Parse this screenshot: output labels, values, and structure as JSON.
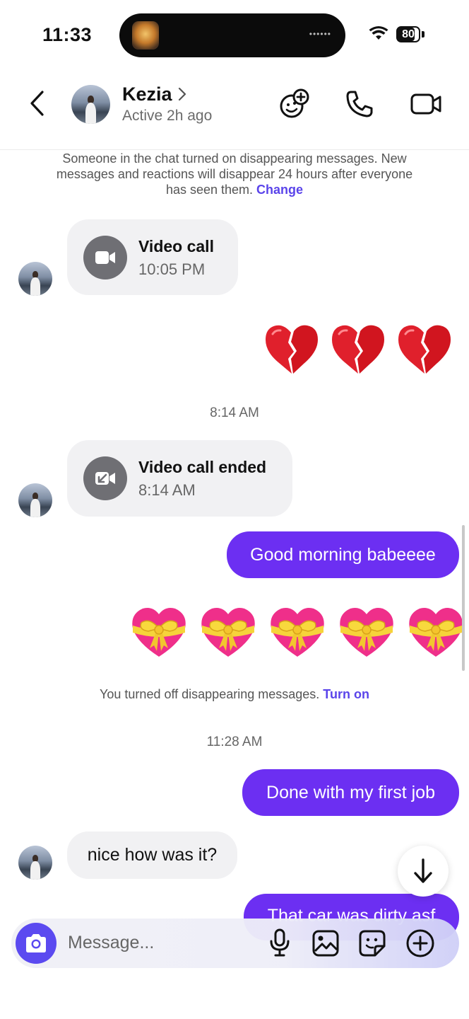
{
  "status_bar": {
    "time": "11:33",
    "island_dots": "••••••",
    "battery_level": 80,
    "battery_text": "80"
  },
  "header": {
    "contact_name": "Kezia",
    "status": "Active 2h ago"
  },
  "messages": {
    "system_notice_1": "Someone in the chat turned on disappearing messages. New messages and reactions will disappear 24 hours after everyone has seen them.",
    "system_notice_1_link": "Change",
    "video_call": {
      "title": "Video call",
      "time": "10:05 PM"
    },
    "broken_hearts": [
      "💔",
      "💔",
      "💔"
    ],
    "timestamp_1": "8:14 AM",
    "video_call_ended": {
      "title": "Video call ended",
      "time": "8:14 AM"
    },
    "sent_1": "Good morning babeeee",
    "gift_hearts": [
      "💝",
      "💝",
      "💝",
      "💝",
      "💝"
    ],
    "system_notice_2": "You turned off disappearing messages.",
    "system_notice_2_link": "Turn on",
    "timestamp_2": "11:28 AM",
    "sent_2": "Done with my first job",
    "received_1": "nice how was it?",
    "sent_3_partial": "That car was dirty asf"
  },
  "composer": {
    "placeholder": "Message..."
  },
  "colors": {
    "accent": "#6c2ff2",
    "link": "#5a44ea",
    "camera_button": "#5b4af0",
    "received_bubble": "#f1f1f3"
  },
  "icons": {
    "back": "chevron-left-icon",
    "effects": "smiley-plus-icon",
    "call": "phone-icon",
    "video": "video-camera-icon",
    "camera": "camera-icon",
    "mic": "microphone-icon",
    "gallery": "image-icon",
    "sticker": "sticker-icon",
    "more": "plus-circle-icon",
    "scroll_down": "arrow-down-icon"
  }
}
